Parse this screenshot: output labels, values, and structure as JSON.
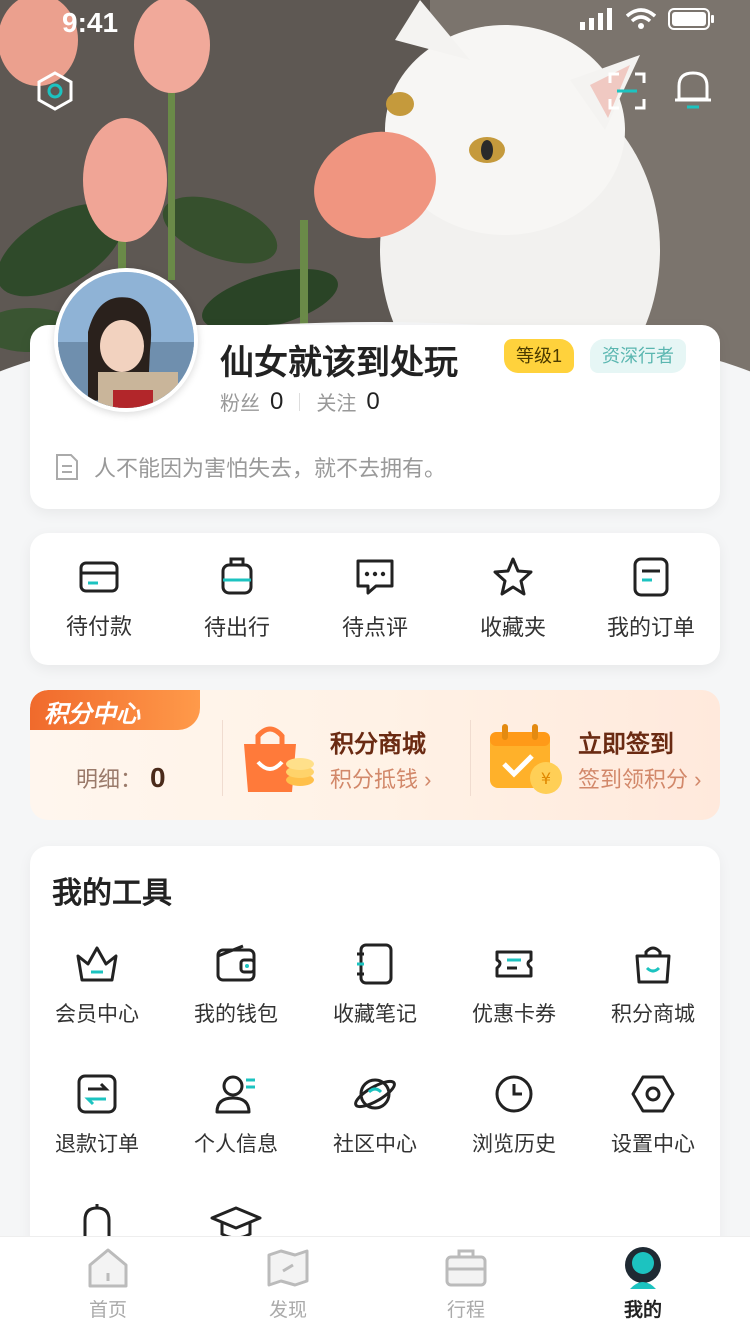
{
  "status_bar": {
    "time": "9:41"
  },
  "profile": {
    "nickname": "仙女就该到处玩",
    "level_badge": "等级1",
    "title_badge": "资深行者",
    "fans_label": "粉丝",
    "fans_count": "0",
    "follow_label": "关注",
    "follow_count": "0",
    "bio": "人不能因为害怕失去，就不去拥有。"
  },
  "orders": [
    {
      "label": "待付款",
      "icon": "card-icon"
    },
    {
      "label": "待出行",
      "icon": "luggage-icon"
    },
    {
      "label": "待点评",
      "icon": "comment-icon"
    },
    {
      "label": "收藏夹",
      "icon": "star-icon"
    },
    {
      "label": "我的订单",
      "icon": "order-icon"
    }
  ],
  "points": {
    "tag": "积分中心",
    "detail_label": "明细：",
    "detail_value": "0",
    "mall_title": "积分商城",
    "mall_sub": "积分抵钱",
    "signin_title": "立即签到",
    "signin_sub": "签到领积分"
  },
  "tools": {
    "title": "我的工具",
    "items": [
      {
        "label": "会员中心",
        "icon": "crown-icon"
      },
      {
        "label": "我的钱包",
        "icon": "wallet-icon"
      },
      {
        "label": "收藏笔记",
        "icon": "notebook-icon"
      },
      {
        "label": "优惠卡券",
        "icon": "ticket-icon"
      },
      {
        "label": "积分商城",
        "icon": "bag-icon"
      },
      {
        "label": "退款订单",
        "icon": "refund-icon"
      },
      {
        "label": "个人信息",
        "icon": "user-icon"
      },
      {
        "label": "社区中心",
        "icon": "planet-icon"
      },
      {
        "label": "浏览历史",
        "icon": "clock-icon"
      },
      {
        "label": "设置中心",
        "icon": "settings-icon"
      }
    ]
  },
  "tabbar": [
    {
      "label": "首页",
      "icon": "home-icon",
      "active": false
    },
    {
      "label": "发现",
      "icon": "map-icon",
      "active": false
    },
    {
      "label": "行程",
      "icon": "suitcase-icon",
      "active": false
    },
    {
      "label": "我的",
      "icon": "profile-icon",
      "active": true
    }
  ],
  "colors": {
    "accent": "#1cc3c0",
    "points_orange": "#f06a2c",
    "level_yellow": "#ffd23c"
  }
}
